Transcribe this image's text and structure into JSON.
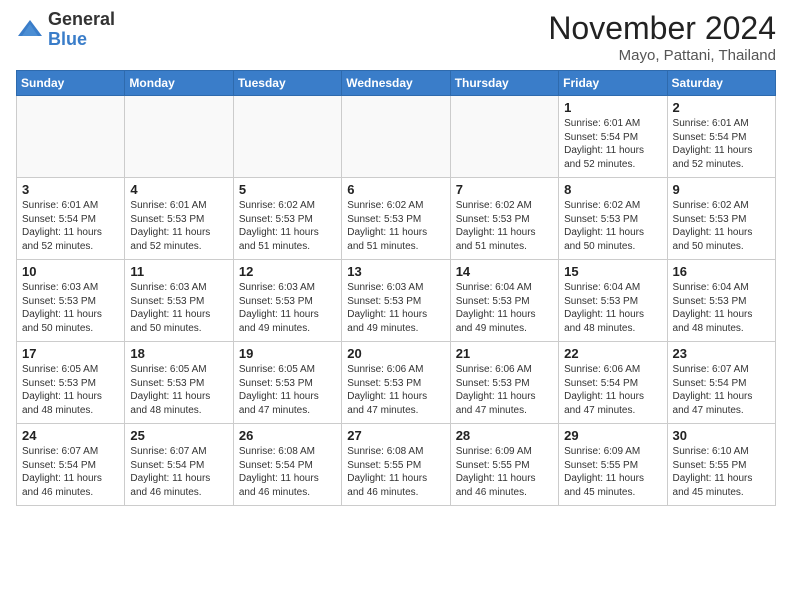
{
  "header": {
    "logo_general": "General",
    "logo_blue": "Blue",
    "month_title": "November 2024",
    "location": "Mayo, Pattani, Thailand"
  },
  "days_of_week": [
    "Sunday",
    "Monday",
    "Tuesday",
    "Wednesday",
    "Thursday",
    "Friday",
    "Saturday"
  ],
  "weeks": [
    [
      {
        "day": "",
        "info": ""
      },
      {
        "day": "",
        "info": ""
      },
      {
        "day": "",
        "info": ""
      },
      {
        "day": "",
        "info": ""
      },
      {
        "day": "",
        "info": ""
      },
      {
        "day": "1",
        "info": "Sunrise: 6:01 AM\nSunset: 5:54 PM\nDaylight: 11 hours\nand 52 minutes."
      },
      {
        "day": "2",
        "info": "Sunrise: 6:01 AM\nSunset: 5:54 PM\nDaylight: 11 hours\nand 52 minutes."
      }
    ],
    [
      {
        "day": "3",
        "info": "Sunrise: 6:01 AM\nSunset: 5:54 PM\nDaylight: 11 hours\nand 52 minutes."
      },
      {
        "day": "4",
        "info": "Sunrise: 6:01 AM\nSunset: 5:53 PM\nDaylight: 11 hours\nand 52 minutes."
      },
      {
        "day": "5",
        "info": "Sunrise: 6:02 AM\nSunset: 5:53 PM\nDaylight: 11 hours\nand 51 minutes."
      },
      {
        "day": "6",
        "info": "Sunrise: 6:02 AM\nSunset: 5:53 PM\nDaylight: 11 hours\nand 51 minutes."
      },
      {
        "day": "7",
        "info": "Sunrise: 6:02 AM\nSunset: 5:53 PM\nDaylight: 11 hours\nand 51 minutes."
      },
      {
        "day": "8",
        "info": "Sunrise: 6:02 AM\nSunset: 5:53 PM\nDaylight: 11 hours\nand 50 minutes."
      },
      {
        "day": "9",
        "info": "Sunrise: 6:02 AM\nSunset: 5:53 PM\nDaylight: 11 hours\nand 50 minutes."
      }
    ],
    [
      {
        "day": "10",
        "info": "Sunrise: 6:03 AM\nSunset: 5:53 PM\nDaylight: 11 hours\nand 50 minutes."
      },
      {
        "day": "11",
        "info": "Sunrise: 6:03 AM\nSunset: 5:53 PM\nDaylight: 11 hours\nand 50 minutes."
      },
      {
        "day": "12",
        "info": "Sunrise: 6:03 AM\nSunset: 5:53 PM\nDaylight: 11 hours\nand 49 minutes."
      },
      {
        "day": "13",
        "info": "Sunrise: 6:03 AM\nSunset: 5:53 PM\nDaylight: 11 hours\nand 49 minutes."
      },
      {
        "day": "14",
        "info": "Sunrise: 6:04 AM\nSunset: 5:53 PM\nDaylight: 11 hours\nand 49 minutes."
      },
      {
        "day": "15",
        "info": "Sunrise: 6:04 AM\nSunset: 5:53 PM\nDaylight: 11 hours\nand 48 minutes."
      },
      {
        "day": "16",
        "info": "Sunrise: 6:04 AM\nSunset: 5:53 PM\nDaylight: 11 hours\nand 48 minutes."
      }
    ],
    [
      {
        "day": "17",
        "info": "Sunrise: 6:05 AM\nSunset: 5:53 PM\nDaylight: 11 hours\nand 48 minutes."
      },
      {
        "day": "18",
        "info": "Sunrise: 6:05 AM\nSunset: 5:53 PM\nDaylight: 11 hours\nand 48 minutes."
      },
      {
        "day": "19",
        "info": "Sunrise: 6:05 AM\nSunset: 5:53 PM\nDaylight: 11 hours\nand 47 minutes."
      },
      {
        "day": "20",
        "info": "Sunrise: 6:06 AM\nSunset: 5:53 PM\nDaylight: 11 hours\nand 47 minutes."
      },
      {
        "day": "21",
        "info": "Sunrise: 6:06 AM\nSunset: 5:53 PM\nDaylight: 11 hours\nand 47 minutes."
      },
      {
        "day": "22",
        "info": "Sunrise: 6:06 AM\nSunset: 5:54 PM\nDaylight: 11 hours\nand 47 minutes."
      },
      {
        "day": "23",
        "info": "Sunrise: 6:07 AM\nSunset: 5:54 PM\nDaylight: 11 hours\nand 47 minutes."
      }
    ],
    [
      {
        "day": "24",
        "info": "Sunrise: 6:07 AM\nSunset: 5:54 PM\nDaylight: 11 hours\nand 46 minutes."
      },
      {
        "day": "25",
        "info": "Sunrise: 6:07 AM\nSunset: 5:54 PM\nDaylight: 11 hours\nand 46 minutes."
      },
      {
        "day": "26",
        "info": "Sunrise: 6:08 AM\nSunset: 5:54 PM\nDaylight: 11 hours\nand 46 minutes."
      },
      {
        "day": "27",
        "info": "Sunrise: 6:08 AM\nSunset: 5:55 PM\nDaylight: 11 hours\nand 46 minutes."
      },
      {
        "day": "28",
        "info": "Sunrise: 6:09 AM\nSunset: 5:55 PM\nDaylight: 11 hours\nand 46 minutes."
      },
      {
        "day": "29",
        "info": "Sunrise: 6:09 AM\nSunset: 5:55 PM\nDaylight: 11 hours\nand 45 minutes."
      },
      {
        "day": "30",
        "info": "Sunrise: 6:10 AM\nSunset: 5:55 PM\nDaylight: 11 hours\nand 45 minutes."
      }
    ]
  ]
}
